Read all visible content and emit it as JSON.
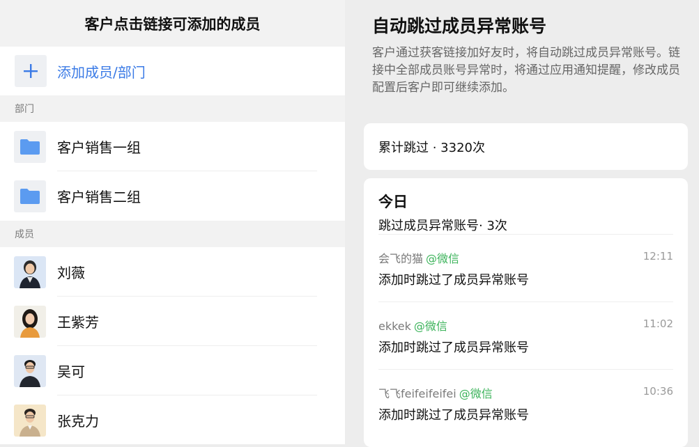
{
  "left": {
    "header_title": "客户点击链接可添加的成员",
    "add_label": "添加成员/部门",
    "departments_header": "部门",
    "departments": [
      {
        "label": "客户销售一组",
        "icon": "folder-icon"
      },
      {
        "label": "客户销售二组",
        "icon": "folder-icon"
      }
    ],
    "members_header": "成员",
    "members": [
      {
        "label": "刘薇",
        "avatar_bg": "#dbe6f5"
      },
      {
        "label": "王紫芳",
        "avatar_bg": "#f1efe8"
      },
      {
        "label": "吴可",
        "avatar_bg": "#dfe7f3"
      },
      {
        "label": "张克力",
        "avatar_bg": "#f5e6c8"
      }
    ]
  },
  "right": {
    "title": "自动跳过成员异常账号",
    "description": "客户通过获客链接加好友时，将自动跳过成员异常账号。链接中全部成员账号异常时，将通过应用通知提醒，修改成员配置后客户即可继续添加。",
    "total_skipped": "累计跳过 · 3320次",
    "today_title": "今日",
    "today_sub": "跳过成员异常账号· 3次",
    "entries": [
      {
        "name": "会飞的猫",
        "source": "@微信",
        "time": "12:11",
        "message": "添加时跳过了成员异常账号"
      },
      {
        "name": "ekkek",
        "source": "@微信",
        "time": "11:02",
        "message": "添加时跳过了成员异常账号"
      },
      {
        "name": "飞飞feifeifeifei",
        "source": "@微信",
        "time": "10:36",
        "message": "添加时跳过了成员异常账号"
      }
    ]
  },
  "colors": {
    "accent_blue": "#3b7be6",
    "wechat_green": "#3bb35a",
    "folder_blue": "#5b9bf0"
  }
}
